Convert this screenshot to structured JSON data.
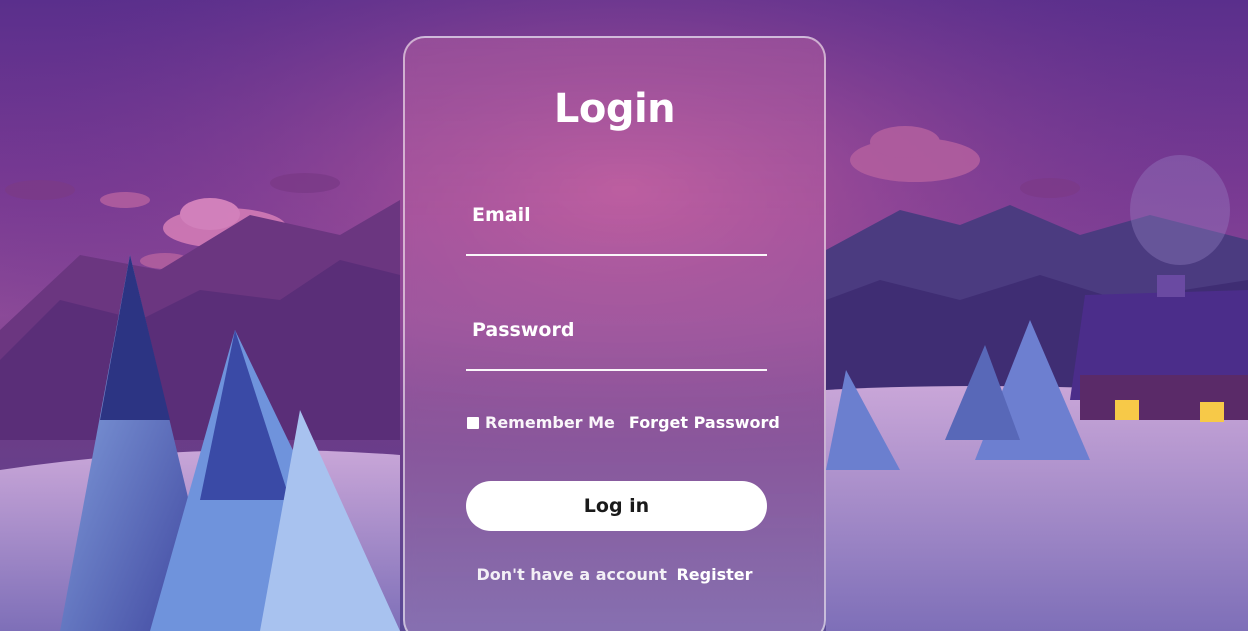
{
  "login_form": {
    "title": "Login",
    "email_label": "Email",
    "password_label": "Password",
    "remember_label": "Remember Me",
    "forgot_password_label": "Forget Password",
    "login_button_label": "Log in",
    "register_prompt": "Don't have a account",
    "register_link_label": "Register"
  },
  "colors": {
    "card_border": "#ffffff",
    "button_background": "#ffffff",
    "button_text": "#1a1a1a",
    "text": "#ffffff"
  }
}
